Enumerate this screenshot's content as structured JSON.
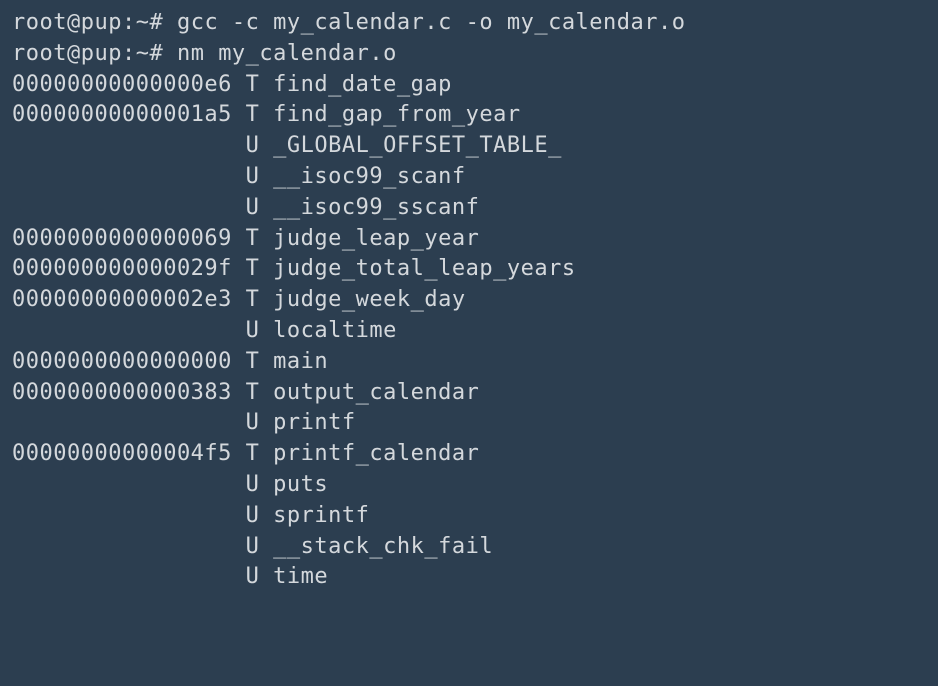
{
  "prompt1": "root@pup:~# ",
  "command1": "gcc -c my_calendar.c -o my_calendar.o",
  "prompt2": "root@pup:~# ",
  "command2": "nm my_calendar.o",
  "symbols": [
    {
      "addr": "00000000000000e6",
      "type": "T",
      "name": "find_date_gap"
    },
    {
      "addr": "00000000000001a5",
      "type": "T",
      "name": "find_gap_from_year"
    },
    {
      "addr": "                ",
      "type": "U",
      "name": "_GLOBAL_OFFSET_TABLE_"
    },
    {
      "addr": "                ",
      "type": "U",
      "name": "__isoc99_scanf"
    },
    {
      "addr": "                ",
      "type": "U",
      "name": "__isoc99_sscanf"
    },
    {
      "addr": "0000000000000069",
      "type": "T",
      "name": "judge_leap_year"
    },
    {
      "addr": "000000000000029f",
      "type": "T",
      "name": "judge_total_leap_years"
    },
    {
      "addr": "00000000000002e3",
      "type": "T",
      "name": "judge_week_day"
    },
    {
      "addr": "                ",
      "type": "U",
      "name": "localtime"
    },
    {
      "addr": "0000000000000000",
      "type": "T",
      "name": "main"
    },
    {
      "addr": "0000000000000383",
      "type": "T",
      "name": "output_calendar"
    },
    {
      "addr": "                ",
      "type": "U",
      "name": "printf"
    },
    {
      "addr": "00000000000004f5",
      "type": "T",
      "name": "printf_calendar"
    },
    {
      "addr": "                ",
      "type": "U",
      "name": "puts"
    },
    {
      "addr": "                ",
      "type": "U",
      "name": "sprintf"
    },
    {
      "addr": "                ",
      "type": "U",
      "name": "__stack_chk_fail"
    },
    {
      "addr": "                ",
      "type": "U",
      "name": "time"
    }
  ]
}
